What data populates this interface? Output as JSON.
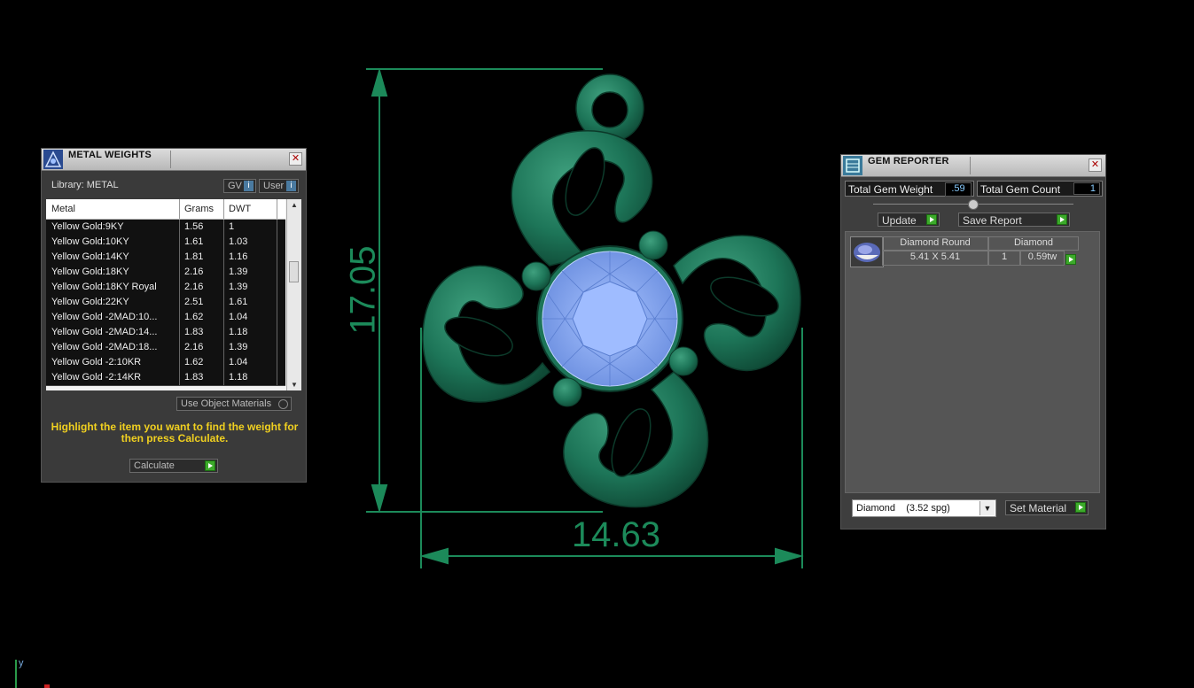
{
  "metal_weights": {
    "title": "METAL WEIGHTS",
    "close": "✕",
    "library_label": "Library: METAL",
    "gv_label": "GV",
    "user_label": "User",
    "columns": [
      "Metal",
      "Grams",
      "DWT"
    ],
    "rows": [
      {
        "metal": "Yellow Gold:9KY",
        "grams": "1.56",
        "dwt": "1"
      },
      {
        "metal": "Yellow Gold:10KY",
        "grams": "1.61",
        "dwt": "1.03"
      },
      {
        "metal": "Yellow Gold:14KY",
        "grams": "1.81",
        "dwt": "1.16"
      },
      {
        "metal": "Yellow Gold:18KY",
        "grams": "2.16",
        "dwt": "1.39"
      },
      {
        "metal": "Yellow Gold:18KY Royal",
        "grams": "2.16",
        "dwt": "1.39"
      },
      {
        "metal": "Yellow Gold:22KY",
        "grams": "2.51",
        "dwt": "1.61"
      },
      {
        "metal": "Yellow Gold -2MAD:10...",
        "grams": "1.62",
        "dwt": "1.04"
      },
      {
        "metal": "Yellow Gold -2MAD:14...",
        "grams": "1.83",
        "dwt": "1.18"
      },
      {
        "metal": "Yellow Gold -2MAD:18...",
        "grams": "2.16",
        "dwt": "1.39"
      },
      {
        "metal": "Yellow Gold -2:10KR",
        "grams": "1.62",
        "dwt": "1.04"
      },
      {
        "metal": "Yellow Gold -2:14KR",
        "grams": "1.83",
        "dwt": "1.18"
      }
    ],
    "use_object_materials": "Use Object Materials",
    "hint": "Highlight the item you want to find the weight for then press Calculate.",
    "calculate": "Calculate"
  },
  "dimensions": {
    "height": "17.05",
    "width": "14.63"
  },
  "gem_reporter": {
    "title": "GEM REPORTER",
    "close": "✕",
    "total_weight_label": "Total Gem Weight",
    "total_weight_value": ".59",
    "total_count_label": "Total Gem Count",
    "total_count_value": "1",
    "update": "Update",
    "save_report": "Save Report",
    "gem": {
      "shape": "Diamond Round",
      "size": "5.41 X 5.41",
      "material": "Diamond",
      "count": "1",
      "weight": "0.59tw"
    },
    "material_select": "Diamond    (3.52 spg)",
    "set_material": "Set Material"
  },
  "axis": {
    "y_label": "y"
  },
  "colors": {
    "metal_green": "#1f7a5a",
    "gem_blue": "#8fb0f0",
    "dimension_green": "#1c8a5a",
    "hint_yellow": "#f0d020"
  }
}
